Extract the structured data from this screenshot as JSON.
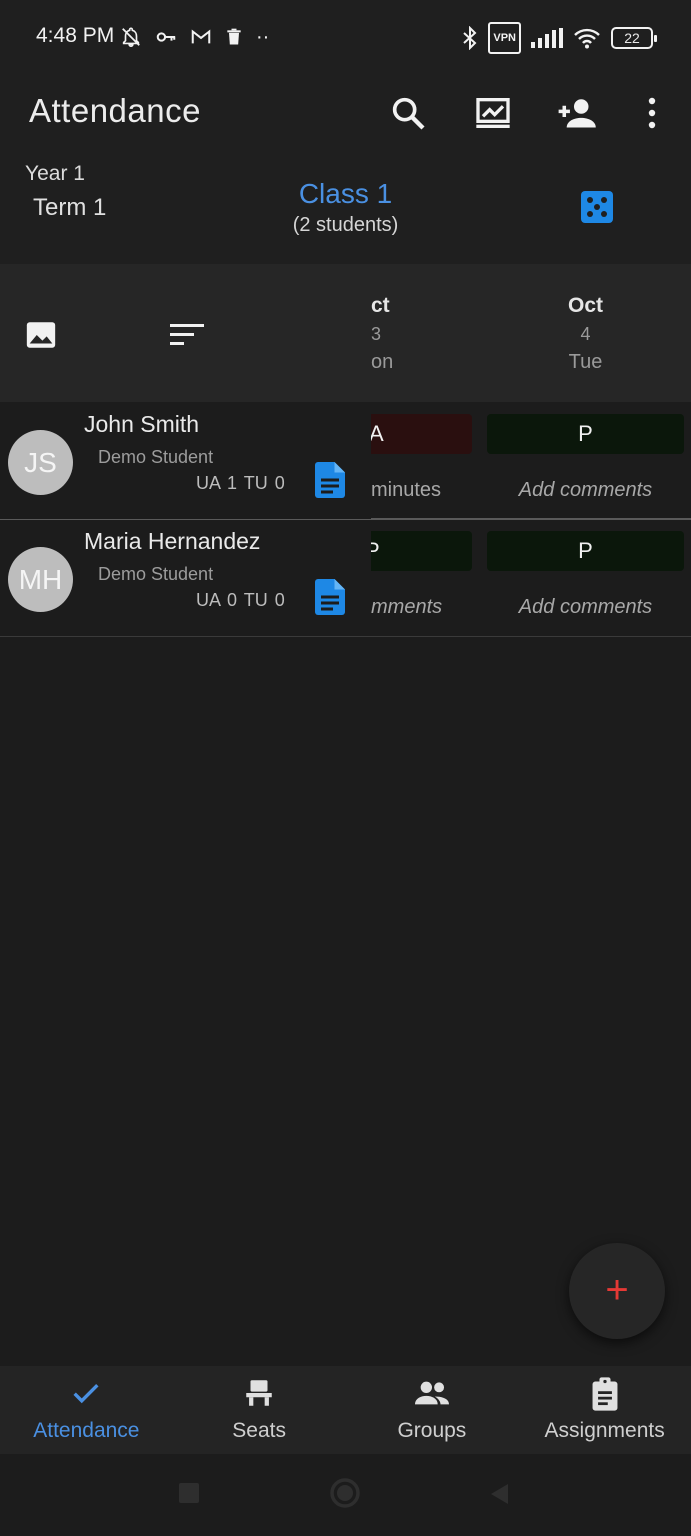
{
  "status_bar": {
    "time": "4:48 PM",
    "battery": "22",
    "vpn": "VPN",
    "icons": [
      "mute-icon",
      "key-icon",
      "gmail-icon",
      "trash-icon",
      "more-dots-icon",
      "bluetooth-icon",
      "vpn-icon",
      "signal-icon",
      "wifi-icon",
      "battery-icon"
    ]
  },
  "app_bar": {
    "title": "Attendance",
    "actions": [
      "search-icon",
      "chart-icon",
      "add-person-icon",
      "overflow-menu-icon"
    ]
  },
  "class_header": {
    "year": "Year 1",
    "term": "Term 1",
    "class_name": "Class 1",
    "student_count": "(2 students)",
    "accent": "#4a90e2"
  },
  "table_header": {
    "dates": [
      {
        "month": "ct",
        "day": "3",
        "weekday": "on"
      },
      {
        "month": "Oct",
        "day": "4",
        "weekday": "Tue"
      }
    ]
  },
  "students": [
    {
      "initials": "JS",
      "name": "John Smith",
      "subtitle": "Demo Student",
      "stats": "UA 1  TU 0",
      "attendance": [
        {
          "mark": "A",
          "comment": " minutes"
        },
        {
          "mark": "P",
          "comment": "Add comments"
        }
      ]
    },
    {
      "initials": "MH",
      "name": "Maria Hernandez",
      "subtitle": "Demo Student",
      "stats": "UA 0  TU 0",
      "attendance": [
        {
          "mark": "P",
          "comment": "mments"
        },
        {
          "mark": "P",
          "comment": "Add comments"
        }
      ]
    }
  ],
  "fab": {
    "label": "+"
  },
  "bottom_nav": [
    {
      "label": "Attendance",
      "icon": "check-icon",
      "active": true
    },
    {
      "label": "Seats",
      "icon": "seat-icon",
      "active": false
    },
    {
      "label": "Groups",
      "icon": "groups-icon",
      "active": false
    },
    {
      "label": "Assignments",
      "icon": "clipboard-icon",
      "active": false
    }
  ]
}
